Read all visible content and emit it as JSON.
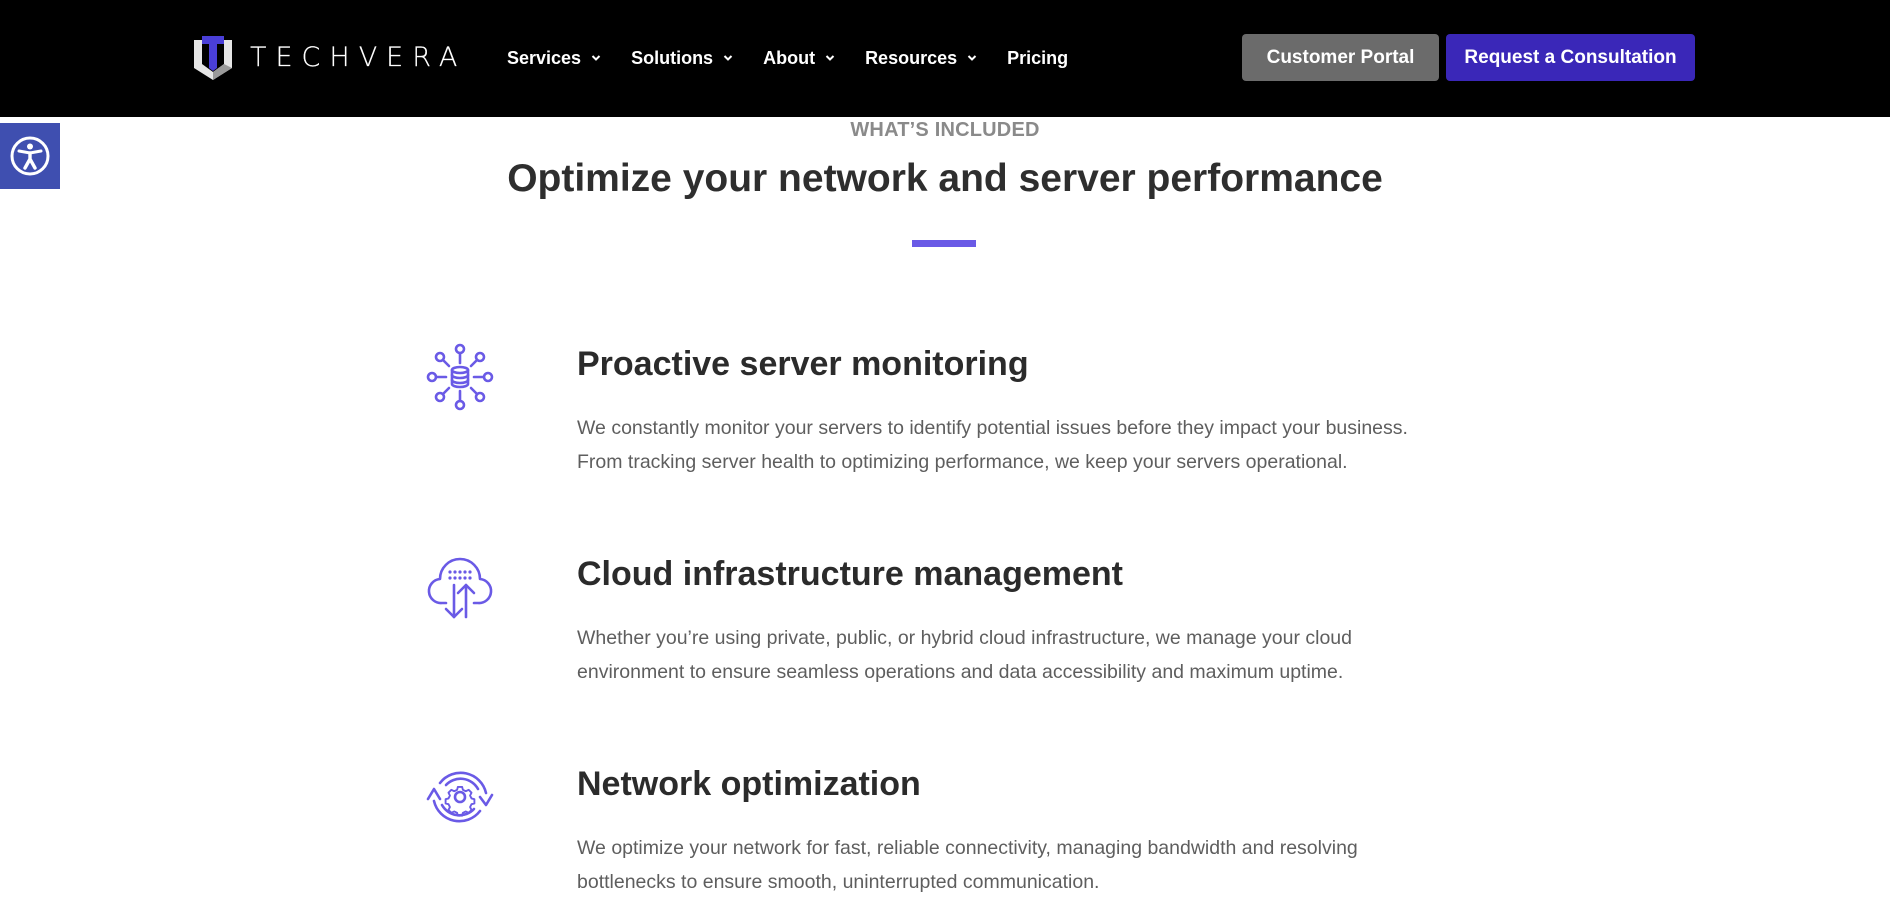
{
  "brand": {
    "name": "TECHVERA",
    "accent_color": "#3a27b8",
    "highlight_color": "#6a5ae6"
  },
  "nav": {
    "items": [
      {
        "label": "Services",
        "has_dropdown": true
      },
      {
        "label": "Solutions",
        "has_dropdown": true
      },
      {
        "label": "About",
        "has_dropdown": true
      },
      {
        "label": "Resources",
        "has_dropdown": true
      },
      {
        "label": "Pricing",
        "has_dropdown": false
      }
    ],
    "customer_portal_label": "Customer Portal",
    "consultation_label": "Request a Consultation"
  },
  "accessibility": {
    "icon": "accessibility-icon"
  },
  "section": {
    "eyebrow": "WHAT’S INCLUDED",
    "heading": "Optimize your network and server performance"
  },
  "features": [
    {
      "icon": "server-network-icon",
      "title": "Proactive server monitoring",
      "body": "We constantly monitor your servers to identify potential issues before they impact your business. From tracking server health to optimizing performance, we keep your servers operational."
    },
    {
      "icon": "cloud-transfer-icon",
      "title": "Cloud infrastructure management",
      "body": "Whether you’re using private, public, or hybrid cloud infrastructure, we manage your cloud environment to ensure seamless operations and data accessibility and maximum uptime."
    },
    {
      "icon": "gear-cycle-icon",
      "title": "Network optimization",
      "body": "We optimize your network for fast, reliable connectivity, managing bandwidth and resolving bottlenecks to ensure smooth, uninterrupted communication."
    }
  ]
}
